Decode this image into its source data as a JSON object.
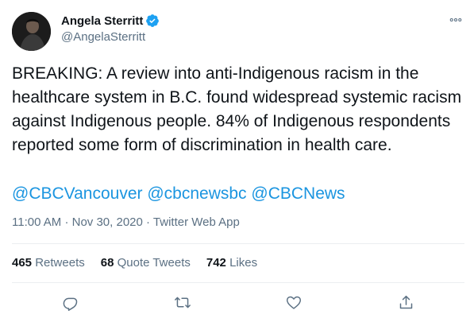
{
  "author": {
    "display_name": "Angela Sterritt",
    "handle": "@AngelaSterritt",
    "avatar_icon": "person-silhouette"
  },
  "tweet": {
    "text": "BREAKING: A review into anti-Indigenous racism in the healthcare system in B.C. found widespread systemic racism against Indigenous people. 84% of Indigenous respondents reported some form of discrimination in health care.",
    "mentions": [
      "@CBCVancouver",
      "@cbcnewsbc",
      "@CBCNews"
    ],
    "time": "11:00 AM",
    "date": "Nov 30, 2020",
    "source": "Twitter Web App",
    "sep": "·"
  },
  "stats": {
    "retweets_count": "465",
    "retweets_label": "Retweets",
    "quotes_count": "68",
    "quotes_label": "Quote Tweets",
    "likes_count": "742",
    "likes_label": "Likes"
  },
  "colors": {
    "link": "#1b95e0",
    "muted": "#5b7083",
    "verified": "#1da1f2"
  }
}
